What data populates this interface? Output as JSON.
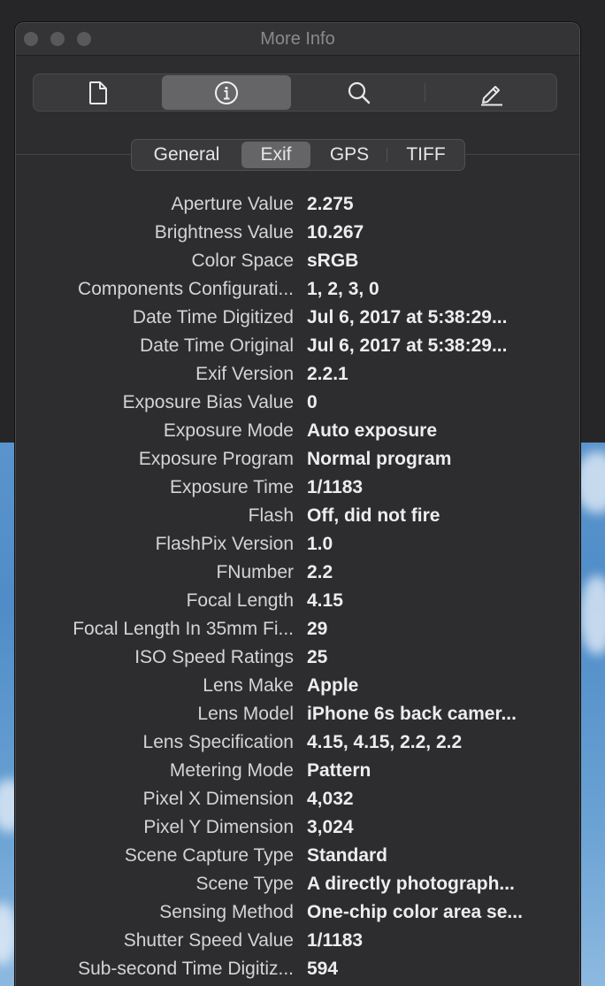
{
  "window": {
    "title": "More Info"
  },
  "toolbar": {
    "items": [
      {
        "icon": "document-icon",
        "active": false
      },
      {
        "icon": "info-icon",
        "active": true
      },
      {
        "icon": "search-icon",
        "active": false
      },
      {
        "icon": "pencil-icon",
        "active": false
      }
    ]
  },
  "tabs": [
    {
      "label": "General",
      "active": false
    },
    {
      "label": "Exif",
      "active": true
    },
    {
      "label": "GPS",
      "active": false
    },
    {
      "label": "TIFF",
      "active": false
    }
  ],
  "exif": [
    {
      "label": "Aperture Value",
      "value": "2.275"
    },
    {
      "label": "Brightness Value",
      "value": "10.267"
    },
    {
      "label": "Color Space",
      "value": "sRGB"
    },
    {
      "label": "Components Configurati...",
      "value": "1, 2, 3, 0"
    },
    {
      "label": "Date Time Digitized",
      "value": "Jul 6, 2017 at 5:38:29..."
    },
    {
      "label": "Date Time Original",
      "value": "Jul 6, 2017 at 5:38:29..."
    },
    {
      "label": "Exif Version",
      "value": "2.2.1"
    },
    {
      "label": "Exposure Bias Value",
      "value": "0"
    },
    {
      "label": "Exposure Mode",
      "value": "Auto exposure"
    },
    {
      "label": "Exposure Program",
      "value": "Normal program"
    },
    {
      "label": "Exposure Time",
      "value": "1/1183"
    },
    {
      "label": "Flash",
      "value": "Off, did not fire"
    },
    {
      "label": "FlashPix Version",
      "value": "1.0"
    },
    {
      "label": "FNumber",
      "value": "2.2"
    },
    {
      "label": "Focal Length",
      "value": "4.15"
    },
    {
      "label": "Focal Length In 35mm Fi...",
      "value": "29"
    },
    {
      "label": "ISO Speed Ratings",
      "value": "25"
    },
    {
      "label": "Lens Make",
      "value": "Apple"
    },
    {
      "label": "Lens Model",
      "value": "iPhone 6s back camer..."
    },
    {
      "label": "Lens Specification",
      "value": "4.15, 4.15, 2.2, 2.2"
    },
    {
      "label": "Metering Mode",
      "value": "Pattern"
    },
    {
      "label": "Pixel X Dimension",
      "value": "4,032"
    },
    {
      "label": "Pixel Y Dimension",
      "value": "3,024"
    },
    {
      "label": "Scene Capture Type",
      "value": "Standard"
    },
    {
      "label": "Scene Type",
      "value": "A directly photograph..."
    },
    {
      "label": "Sensing Method",
      "value": "One-chip color area se..."
    },
    {
      "label": "Shutter Speed Value",
      "value": "1/1183"
    },
    {
      "label": "Sub-second Time Digitiz...",
      "value": "594"
    }
  ]
}
